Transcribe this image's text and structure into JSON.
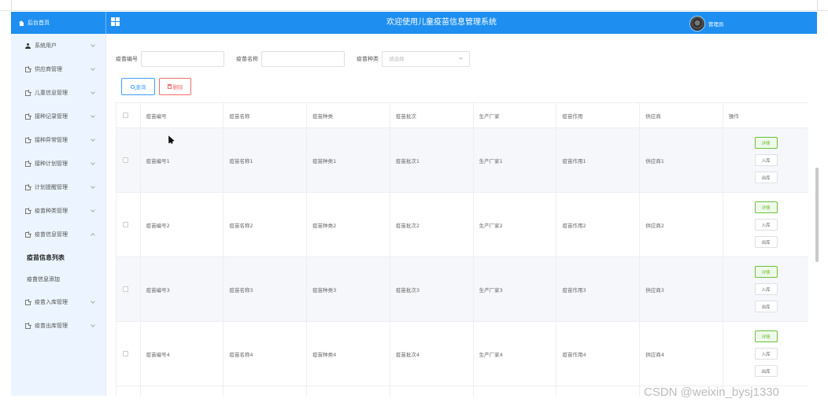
{
  "header": {
    "brand": "后台首页",
    "title": "欢迎使用儿童疫苗信息管理系统",
    "user": "管理员"
  },
  "sidebar": {
    "items": [
      {
        "label": "系统用户",
        "icon": "user-icon",
        "expanded": false
      },
      {
        "label": "供应商管理",
        "icon": "document-icon",
        "expanded": false
      },
      {
        "label": "儿童信息管理",
        "icon": "document-icon",
        "expanded": false
      },
      {
        "label": "接种记录管理",
        "icon": "document-icon",
        "expanded": false
      },
      {
        "label": "接种异常管理",
        "icon": "document-icon",
        "expanded": false
      },
      {
        "label": "接种计划管理",
        "icon": "document-icon",
        "expanded": false
      },
      {
        "label": "计划提醒管理",
        "icon": "document-icon",
        "expanded": false
      },
      {
        "label": "疫苗种类管理",
        "icon": "document-icon",
        "expanded": false
      },
      {
        "label": "疫苗信息管理",
        "icon": "document-icon",
        "expanded": true
      }
    ],
    "sub_items": [
      "疫苗信息列表",
      "疫苗信息添加"
    ],
    "after_items": [
      {
        "label": "疫苗入库管理",
        "icon": "document-icon"
      },
      {
        "label": "疫苗出库管理",
        "icon": "document-icon"
      }
    ]
  },
  "search": {
    "code_label": "疫苗编号",
    "name_label": "疫苗名称",
    "type_label": "疫苗种类",
    "type_placeholder": "请选择"
  },
  "actions": {
    "search": "查询",
    "delete": "删除"
  },
  "table": {
    "headers": [
      "疫苗编号",
      "疫苗名称",
      "疫苗种类",
      "疫苗批次",
      "生产厂家",
      "疫苗作用",
      "供应商",
      "操作"
    ],
    "rows": [
      [
        "疫苗编号1",
        "疫苗名称1",
        "疫苗种类1",
        "疫苗批次1",
        "生产厂家1",
        "疫苗作用1",
        "供应商1"
      ],
      [
        "疫苗编号2",
        "疫苗名称2",
        "疫苗种类2",
        "疫苗批次2",
        "生产厂家2",
        "疫苗作用2",
        "供应商2"
      ],
      [
        "疫苗编号3",
        "疫苗名称3",
        "疫苗种类3",
        "疫苗批次3",
        "生产厂家3",
        "疫苗作用3",
        "供应商3"
      ],
      [
        "疫苗编号4",
        "疫苗名称4",
        "疫苗种类4",
        "疫苗批次4",
        "生产厂家4",
        "疫苗作用4",
        "供应商4"
      ]
    ],
    "row_actions": [
      "详情",
      "入库",
      "出库"
    ]
  },
  "watermark": "CSDN @weixin_bysj1330",
  "colors": {
    "header": "#1e8ff0",
    "sidebar": "#ecf5ff",
    "primary": "#409eff",
    "danger": "#f56c6c",
    "success": "#67c23a"
  }
}
